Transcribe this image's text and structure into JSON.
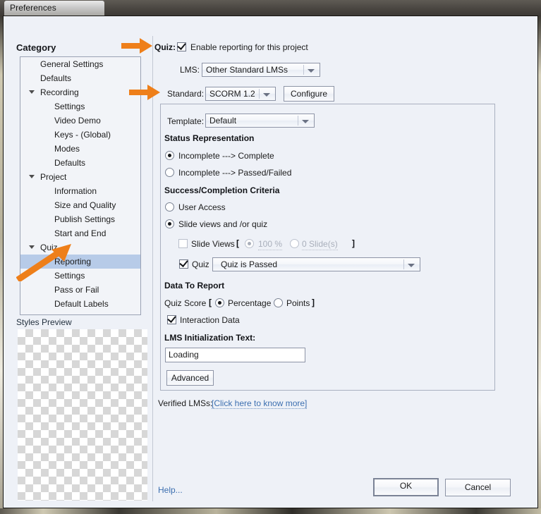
{
  "window": {
    "title": "Preferences"
  },
  "sidebar": {
    "header": "Category",
    "items": [
      {
        "label": "General Settings",
        "level": 1,
        "expandable": false,
        "selected": false
      },
      {
        "label": "Defaults",
        "level": 1,
        "expandable": false,
        "selected": false
      },
      {
        "label": "Recording",
        "level": 1,
        "expandable": true,
        "selected": false
      },
      {
        "label": "Settings",
        "level": 2,
        "expandable": false,
        "selected": false
      },
      {
        "label": "Video Demo",
        "level": 2,
        "expandable": false,
        "selected": false
      },
      {
        "label": "Keys - (Global)",
        "level": 2,
        "expandable": false,
        "selected": false
      },
      {
        "label": "Modes",
        "level": 2,
        "expandable": false,
        "selected": false
      },
      {
        "label": "Defaults",
        "level": 2,
        "expandable": false,
        "selected": false
      },
      {
        "label": "Project",
        "level": 1,
        "expandable": true,
        "selected": false
      },
      {
        "label": "Information",
        "level": 2,
        "expandable": false,
        "selected": false
      },
      {
        "label": "Size and Quality",
        "level": 2,
        "expandable": false,
        "selected": false
      },
      {
        "label": "Publish Settings",
        "level": 2,
        "expandable": false,
        "selected": false
      },
      {
        "label": "Start and End",
        "level": 2,
        "expandable": false,
        "selected": false
      },
      {
        "label": "Quiz",
        "level": 1,
        "expandable": true,
        "selected": false
      },
      {
        "label": "Reporting",
        "level": 2,
        "expandable": false,
        "selected": true
      },
      {
        "label": "Settings",
        "level": 2,
        "expandable": false,
        "selected": false
      },
      {
        "label": "Pass or Fail",
        "level": 2,
        "expandable": false,
        "selected": false
      },
      {
        "label": "Default Labels",
        "level": 2,
        "expandable": false,
        "selected": false
      }
    ],
    "styles_preview_label": "Styles Preview"
  },
  "main": {
    "quiz_label": "Quiz:",
    "enable_reporting_label": "Enable reporting for this project",
    "enable_reporting_checked": true,
    "lms_label": "LMS:",
    "lms_value": "Other Standard LMSs",
    "standard_label": "Standard:",
    "standard_value": "SCORM 1.2",
    "configure_label": "Configure",
    "template_label": "Template:",
    "template_value": "Default",
    "status_representation": {
      "heading": "Status Representation",
      "options": [
        {
          "label": "Incomplete ---> Complete",
          "selected": true
        },
        {
          "label": "Incomplete ---> Passed/Failed",
          "selected": false
        }
      ]
    },
    "success_criteria": {
      "heading": "Success/Completion Criteria",
      "options": [
        {
          "label": "User Access",
          "selected": false
        },
        {
          "label": "Slide views and /or quiz",
          "selected": true
        }
      ],
      "slide_views": {
        "label": "Slide Views",
        "checked": false,
        "bracket_open": "[",
        "bracket_close": "]",
        "percent_option": {
          "label": "100 %",
          "value": "100",
          "unit": "%",
          "selected": true,
          "disabled": true
        },
        "slides_option": {
          "label": "0 Slide(s)",
          "value": "0",
          "unit": "Slide(s)",
          "selected": false,
          "disabled": true
        }
      },
      "quiz_row": {
        "label": "Quiz",
        "checked": true,
        "value": "Quiz is Passed"
      }
    },
    "data_to_report": {
      "heading": "Data To Report",
      "quiz_score_label": "Quiz Score",
      "bracket_open": "[",
      "bracket_close": "]",
      "score_options": [
        {
          "label": "Percentage",
          "selected": true
        },
        {
          "label": "Points",
          "selected": false
        }
      ],
      "interaction_data_label": "Interaction Data",
      "interaction_data_checked": true
    },
    "lms_init": {
      "heading": "LMS Initialization Text:",
      "value": "Loading"
    },
    "advanced_label": "Advanced",
    "verified_lmss_label": "Verified LMSs:",
    "verified_lmss_link": "[Click here to know more]"
  },
  "footer": {
    "help_label": "Help...",
    "ok_label": "OK",
    "cancel_label": "Cancel"
  },
  "annotations": {
    "color": "#ee7f1a",
    "arrow_quiz": "arrow-pointing-to-quiz-row",
    "arrow_standard": "arrow-pointing-to-standard-row",
    "arrow_reporting": "arrow-pointing-to-reporting-item"
  }
}
